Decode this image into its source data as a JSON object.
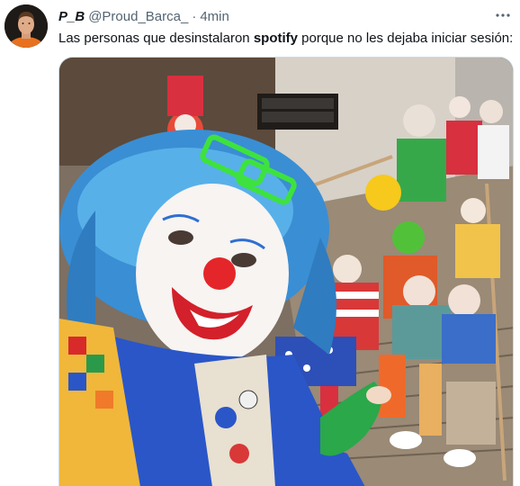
{
  "tweet": {
    "author_name": "P_B",
    "handle": "@Proud_Barca_",
    "separator": "·",
    "timestamp": "4min",
    "text_before": "Las personas que desinstalaron ",
    "text_bold": "spotify",
    "text_after": " porque no les dejaba iniciar sesión:",
    "more_icon": "more-horizontal-icon",
    "avatar_alt": "profile photo",
    "media_description_icon": "photo-media"
  },
  "colors": {
    "secondary_text": "#536471",
    "border": "#cfd9de",
    "primary_text": "#0f1419"
  }
}
